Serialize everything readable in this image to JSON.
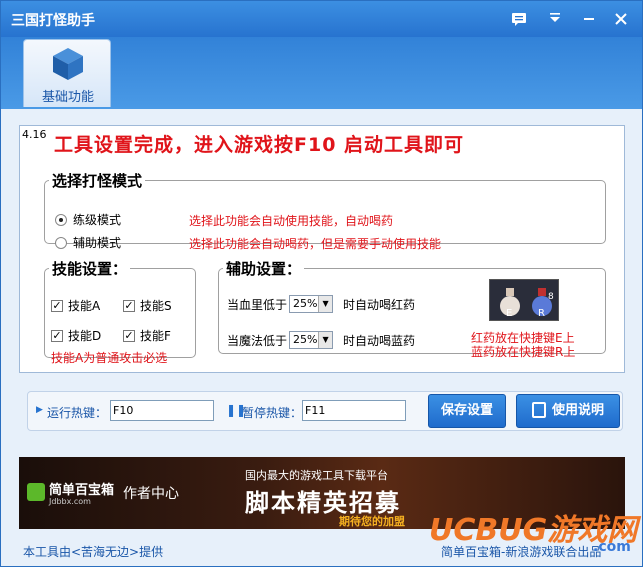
{
  "window": {
    "title": "三国打怪助手",
    "controls": [
      "chat-icon",
      "menu-icon",
      "minimize-icon",
      "close-icon"
    ]
  },
  "toolbar": {
    "tab_label": "基础功能"
  },
  "panel": {
    "version": "4.16",
    "headline": "工具设置完成，进入游戏按F10 启动工具即可",
    "mode": {
      "legend": "选择打怪模式",
      "options": [
        {
          "label": "练级模式",
          "selected": true,
          "note": "选择此功能会自动使用技能，自动喝药"
        },
        {
          "label": "辅助模式",
          "selected": false,
          "note": "选择此功能会自动喝药，但是需要手动使用技能"
        }
      ]
    },
    "skills": {
      "legend": "技能设置：",
      "items": [
        {
          "label": "技能A",
          "checked": true
        },
        {
          "label": "技能S",
          "checked": true
        },
        {
          "label": "技能D",
          "checked": true
        },
        {
          "label": "技能F",
          "checked": true
        }
      ],
      "note": "技能A为普通攻击必选"
    },
    "aux": {
      "legend": "辅助设置：",
      "hp_prefix": "当血里低于",
      "hp_value": "25%",
      "hp_suffix": "时自动喝红药",
      "mp_prefix": "当魔法低于",
      "mp_value": "25%",
      "mp_suffix": "时自动喝蓝药",
      "note_red": "红药放在快捷键E上",
      "note_blue": "蓝药放在快捷键R上",
      "key_e": "E",
      "key_r": "R",
      "key_mp_count": "8"
    }
  },
  "hotkeys": {
    "run_label": "运行热键：",
    "run_value": "F10",
    "pause_label": "暂停热键：",
    "pause_value": "F11",
    "save_label": "保存设置",
    "help_label": "使用说明"
  },
  "banner": {
    "brand": "简单百宝箱",
    "brand_sub": "Jdbbx.com",
    "author": "作者中心",
    "top_text": "国内最大的游戏工具下载平台",
    "main_text": "脚本精英招募",
    "sub_text": "期待您的加盟"
  },
  "footer": {
    "left": "本工具由<苦海无边>提供",
    "right": "简单百宝箱-新浪游戏联合出品"
  },
  "watermark": {
    "text": "UCBUG游戏网",
    "sub": ".com"
  },
  "colors": {
    "accent": "#2773cf",
    "red": "#e0141a",
    "blue_text": "#1a56a8"
  }
}
